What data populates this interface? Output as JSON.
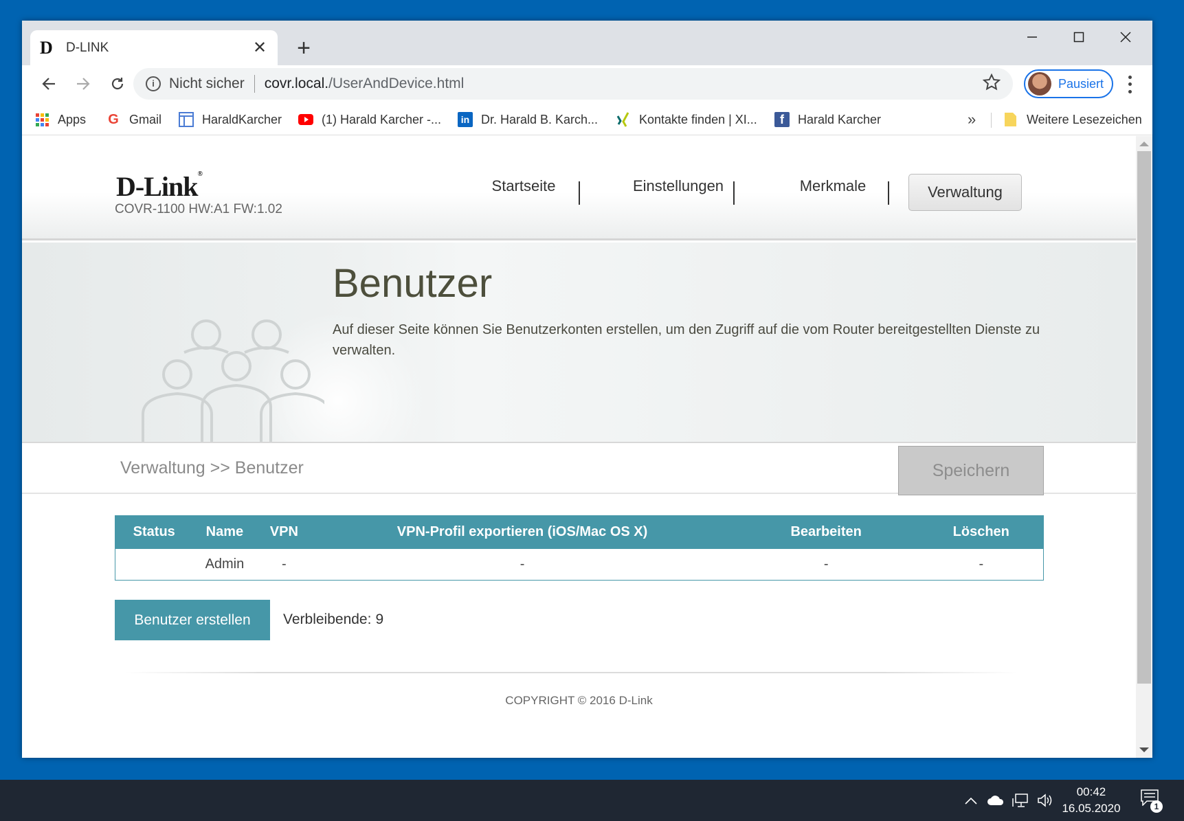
{
  "browser": {
    "tab_title": "D-LINK",
    "tab_favicon": "D",
    "security_label": "Nicht sicher",
    "url_host": "covr.local.",
    "url_path": "/UserAndDevice.html",
    "profile_label": "Pausiert"
  },
  "bookmarks": {
    "items": [
      {
        "label": "Apps",
        "icon": "apps-grid-icon"
      },
      {
        "label": "Gmail",
        "icon": "google-icon"
      },
      {
        "label": "HaraldKarcher",
        "icon": "page-icon"
      },
      {
        "label": "(1) Harald Karcher -...",
        "icon": "youtube-icon"
      },
      {
        "label": "Dr. Harald B. Karch...",
        "icon": "linkedin-icon"
      },
      {
        "label": "Kontakte finden | XI...",
        "icon": "xing-icon"
      },
      {
        "label": "Harald Karcher",
        "icon": "facebook-icon"
      }
    ],
    "more": "»",
    "other_folder": "Weitere Lesezeichen"
  },
  "router": {
    "logo": "D-Link",
    "model": "COVR-1100 HW:A1 FW:1.02",
    "nav": [
      "Startseite",
      "Einstellungen",
      "Merkmale",
      "Verwaltung"
    ],
    "active_nav": "Verwaltung",
    "page_title": "Benutzer",
    "page_description": "Auf dieser Seite können Sie Benutzerkonten erstellen, um den Zugriff auf die vom Router bereitgestellten Dienste zu verwalten.",
    "breadcrumb": "Verwaltung >> Benutzer",
    "save_label": "Speichern",
    "table": {
      "headers": [
        "Status",
        "Name",
        "VPN",
        "VPN-Profil exportieren (iOS/Mac OS X)",
        "Bearbeiten",
        "Löschen"
      ],
      "rows": [
        [
          "",
          "Admin",
          "-",
          "-",
          "-",
          "-"
        ]
      ]
    },
    "create_label": "Benutzer erstellen",
    "remaining_label": "Verbleibende:",
    "remaining_value": "9",
    "copyright": "COPYRIGHT © 2016 D-Link"
  },
  "taskbar": {
    "time": "00:42",
    "date": "16.05.2020",
    "notification_count": "1"
  },
  "colors": {
    "desktop": "#0063b1",
    "accent_teal": "#4697a8",
    "taskbar": "#1f2733",
    "chrome_profile": "#1a73e8"
  }
}
